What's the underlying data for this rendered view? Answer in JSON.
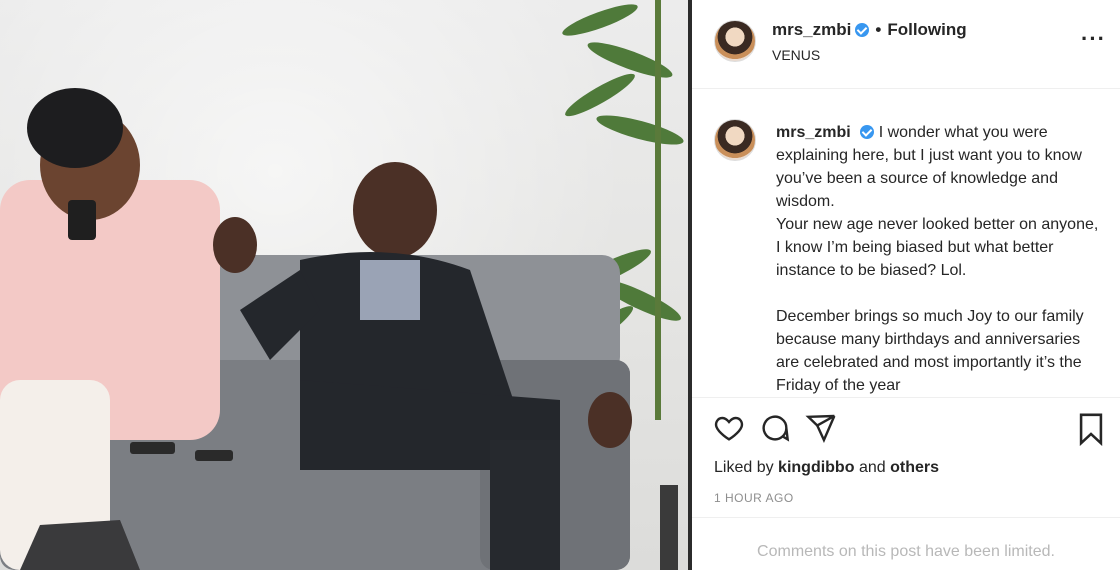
{
  "post": {
    "username": "mrs_zmbi",
    "separator": "•",
    "follow_status": "Following",
    "location": "VENUS",
    "more_icon": "more-horizontal-icon",
    "caption_text": "I wonder what you were explaining here, but I just want you to know you’ve been a source of knowledge and wisdom.\nYour new age never looked better on anyone, I know I’m being biased but what better instance to be biased? Lol.\n\nDecember brings so much Joy to our family because many birthdays and anniversaries are celebrated and most importantly it’s the Friday of the year",
    "likes_prefix": "Liked by",
    "likes_user": "kingdibbo",
    "likes_and": "and",
    "likes_others": "others",
    "timestamp": "1 HOUR AGO",
    "comments_notice": "Comments on this post have been limited."
  },
  "icons": {
    "like": "heart-icon",
    "comment": "comment-icon",
    "share": "send-icon",
    "save": "bookmark-icon"
  },
  "colors": {
    "verified": "#3897f0",
    "muted": "#8e8e8e",
    "text": "#262626"
  }
}
